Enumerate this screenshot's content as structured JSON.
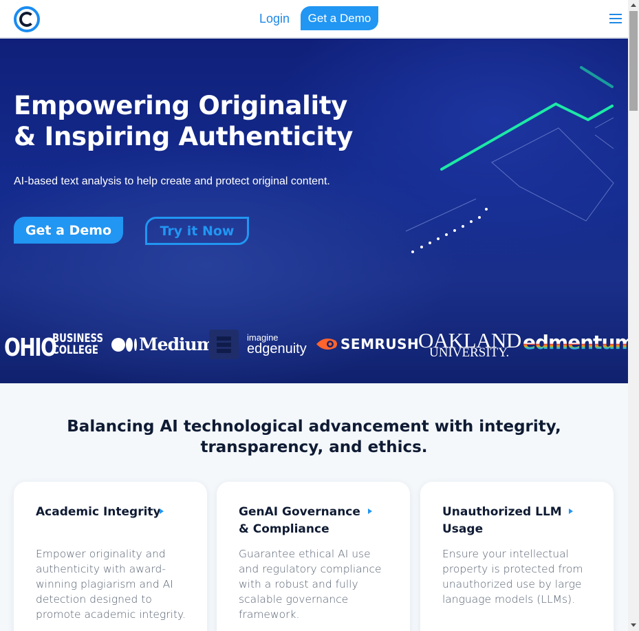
{
  "header": {
    "login_label": "Login",
    "demo_label": "Get a Demo"
  },
  "hero": {
    "title_line1": "Empowering Originality",
    "title_line2": "& Inspiring Authenticity",
    "subtitle": "AI-based text analysis to help create and protect original content.",
    "demo_label": "Get a Demo",
    "try_label": "Try it Now"
  },
  "partners": {
    "ohio": "OHIO",
    "ohio_sub1": "BUSINESS",
    "ohio_sub2": "COLLEGE",
    "medium": "Medium",
    "imagine": "imagine",
    "edgenuity": "edgenuity",
    "semrush": "SEMRUSH",
    "oakland": "OAKLAND",
    "oakland_sub": "UNIVERSITY.",
    "edmentum": "edmentum"
  },
  "section": {
    "title": "Balancing AI technological advancement with integrity, transparency, and ethics."
  },
  "cards": [
    {
      "title": "Academic Integrity",
      "description": "Empower originality and authenticity with award-winning plagiarism and AI detection designed to promote academic integrity."
    },
    {
      "title": "GenAI Governance & Compliance",
      "description": "Guarantee ethical AI use and regulatory compliance with a robust and fully scalable governance framework."
    },
    {
      "title": "Unauthorized LLM Usage",
      "description": "Ensure your intellectual property is protected from unauthorized use by large language models (LLMs)."
    }
  ],
  "colors": {
    "accent": "#2196f3",
    "hero_bg": "#142b8e",
    "heading": "#0f1b33",
    "graphic_green": "#1de9a6"
  },
  "icons": {
    "logo": "copyleaks-logo-icon",
    "menu": "hamburger-menu-icon",
    "card_arrow": "caret-right-icon"
  }
}
